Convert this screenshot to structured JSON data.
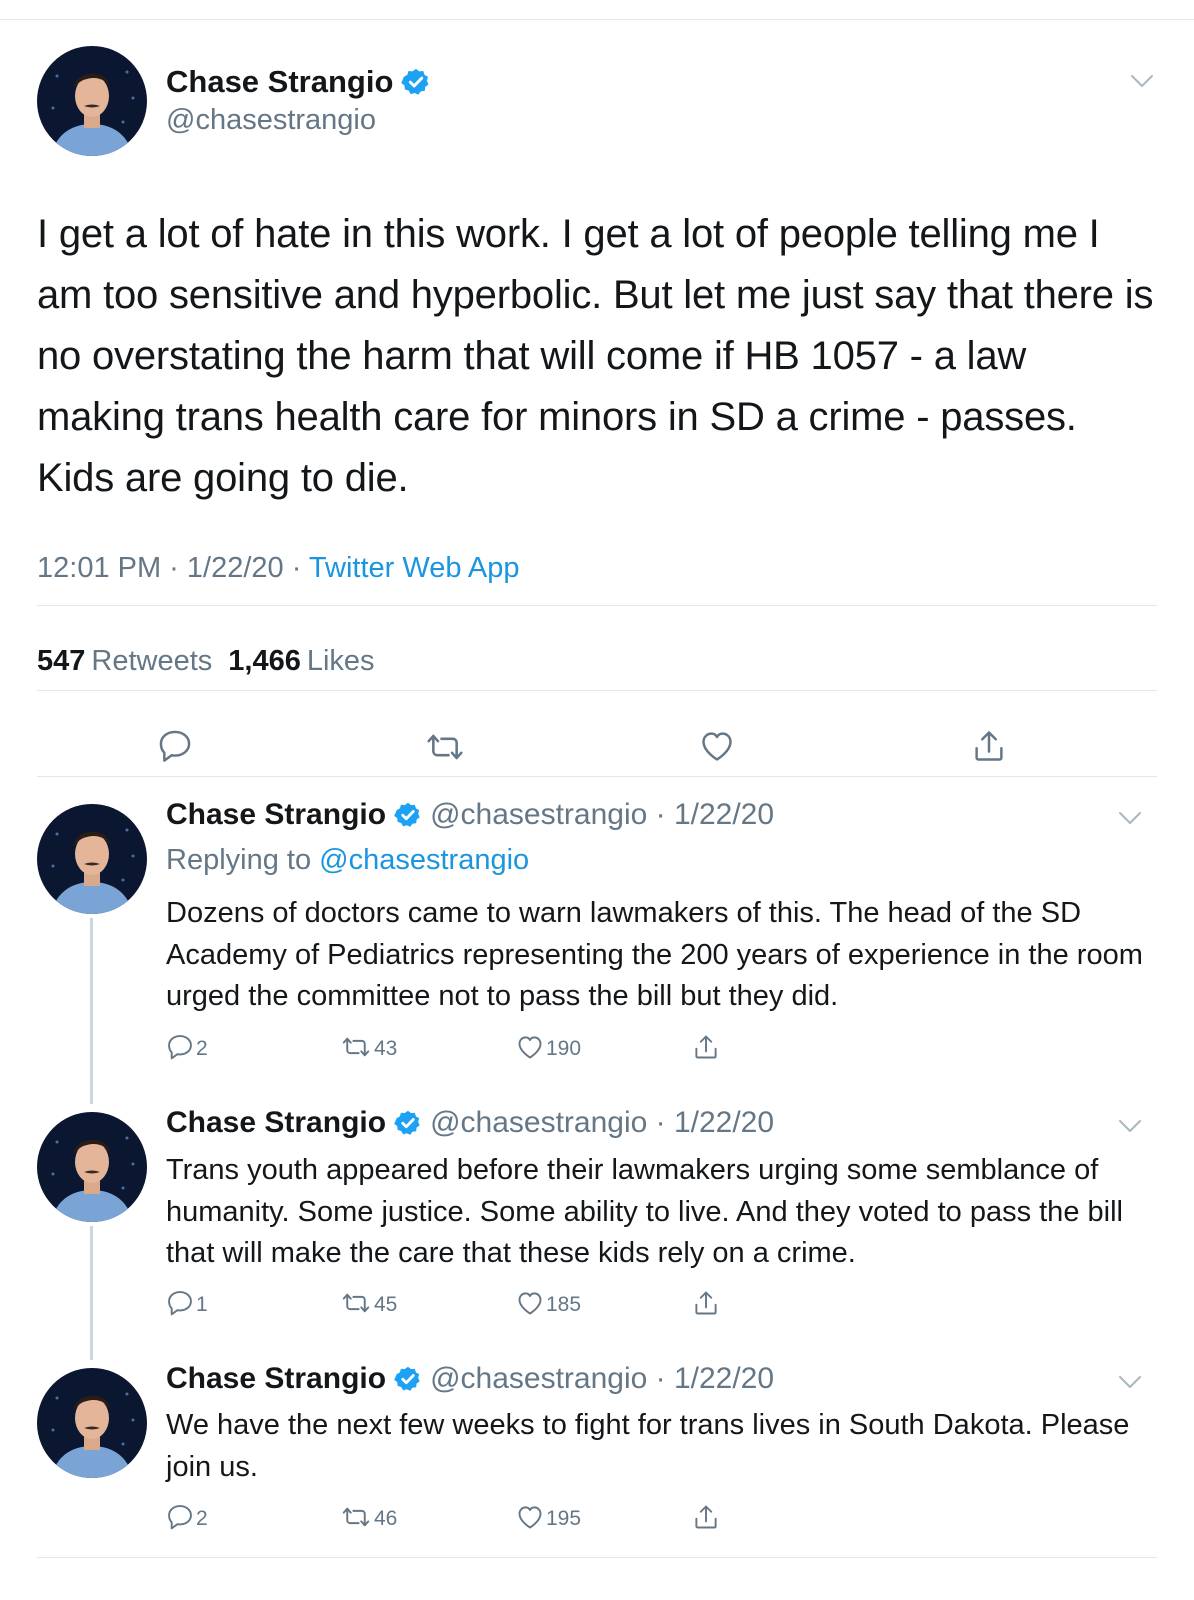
{
  "main": {
    "name": "Chase Strangio",
    "handle": "@chasestrangio",
    "text": "I get a lot of hate in this work. I get a lot of people telling me I am too sensitive and hyperbolic. But let me just say that there is no overstating the harm that will come if HB 1057 - a law making trans health care for minors in SD a crime - passes. Kids are going to die.",
    "time": "12:01 PM · 1/22/20 · ",
    "source": "Twitter Web App",
    "retweets_count": "547",
    "retweets_label": "Retweets",
    "likes_count": "1,466",
    "likes_label": "Likes"
  },
  "replies": [
    {
      "name": "Chase Strangio",
      "handle_date": "@chasestrangio · 1/22/20",
      "replying_prefix": "Replying to ",
      "replying_handle": "@chasestrangio",
      "text": "Dozens of doctors came to warn lawmakers of this. The head of the SD Academy of Pediatrics representing the 200 years of experience in the room urged the committee not to pass the bill but they did.",
      "replies": "2",
      "retweets": "43",
      "likes": "190"
    },
    {
      "name": "Chase Strangio",
      "handle_date": "@chasestrangio · 1/22/20",
      "text": "Trans youth appeared before their lawmakers urging some semblance of humanity. Some justice. Some ability to live. And they voted to pass the bill that will make the care that these kids rely on a crime.",
      "replies": "1",
      "retweets": "45",
      "likes": "185"
    },
    {
      "name": "Chase Strangio",
      "handle_date": "@chasestrangio · 1/22/20",
      "text": "We have the next few weeks to fight for trans lives in South Dakota. Please join us.",
      "replies": "2",
      "retweets": "46",
      "likes": "195"
    }
  ],
  "icons": {
    "verified": "verified-badge-icon",
    "reply": "reply-icon",
    "retweet": "retweet-icon",
    "like": "heart-icon",
    "share": "share-icon",
    "more": "chevron-down-icon"
  },
  "colors": {
    "accent": "#1b95e0",
    "muted": "#657786",
    "text": "#14171a",
    "verified": "#1da1f2"
  }
}
